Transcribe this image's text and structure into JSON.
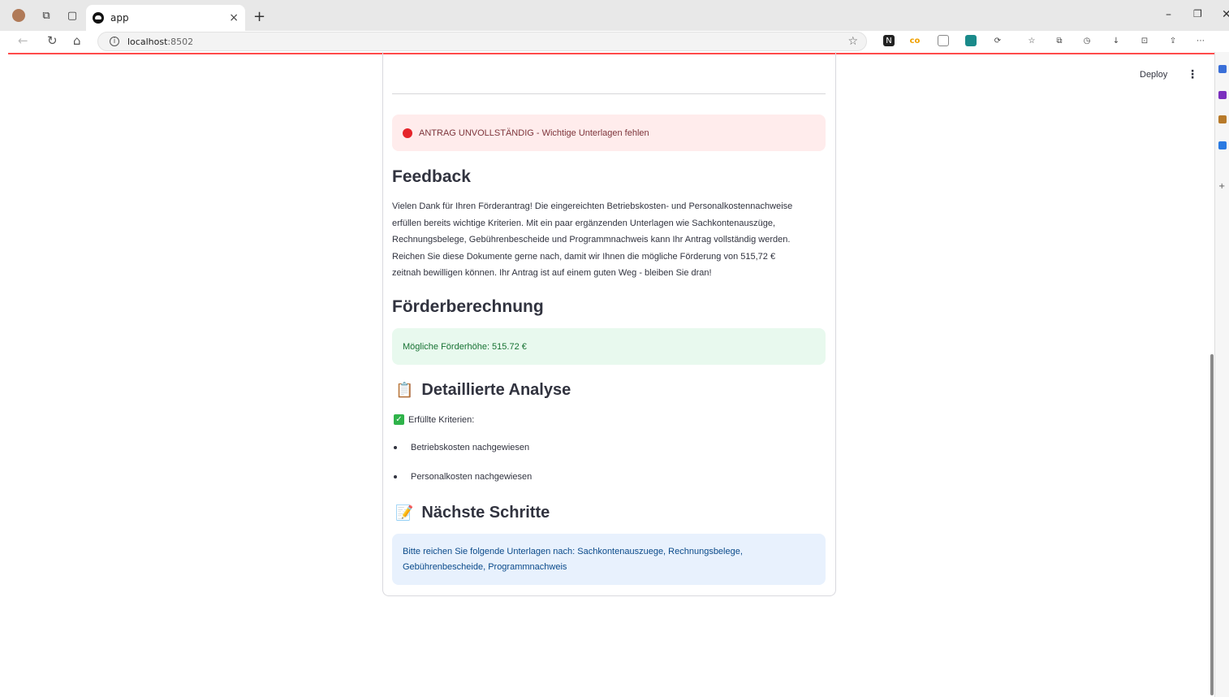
{
  "browser": {
    "tab_title": "app",
    "tab_close": "×",
    "new_tab": "+",
    "url_host": "localhost",
    "url_port": ":8502",
    "minimize": "–",
    "restore": "❐",
    "close": "✕"
  },
  "header": {
    "deploy_label": "Deploy",
    "menu_icon": "⋮"
  },
  "status_alert": {
    "text": "ANTRAG UNVOLLSTÄNDIG - Wichtige Unterlagen fehlen",
    "color": "#e5242a"
  },
  "feedback": {
    "heading": "Feedback",
    "lines": [
      "Vielen Dank für Ihren Förderantrag! Die eingereichten Betriebskosten- und Personalkostennachweise",
      "erfüllen bereits wichtige Kriterien. Mit ein paar ergänzenden Unterlagen wie Sachkontenauszüge,",
      "Rechnungsbelege, Gebührenbescheide und Programmnachweis kann Ihr Antrag vollständig werden.",
      "Reichen Sie diese Dokumente gerne nach, damit wir Ihnen die mögliche Förderung von 515,72 €",
      "zeitnah bewilligen können. Ihr Antrag ist auf einem guten Weg - bleiben Sie dran!"
    ]
  },
  "calculation": {
    "heading": "Förderberechnung",
    "result": "Mögliche Förderhöhe: 515.72 €"
  },
  "analysis": {
    "emoji": "📋",
    "heading": "Detaillierte Analyse",
    "criteria_label": "Erfüllte Kriterien:",
    "items": [
      "Betriebskosten nachgewiesen",
      "Personalkosten nachgewiesen"
    ]
  },
  "next_steps": {
    "emoji": "📝",
    "heading": "Nächste Schritte",
    "line1": "Bitte reichen Sie folgende Unterlagen nach: Sachkontenauszuege, Rechnungsbelege,",
    "line2": "Gebührenbescheide, Programmnachweis"
  },
  "colors": {
    "accent": "#ff4b4b",
    "success": "#2fb34a",
    "error_bg": "#ffecec",
    "success_bg": "#e8f9ee",
    "info_bg": "#e8f1fd"
  }
}
